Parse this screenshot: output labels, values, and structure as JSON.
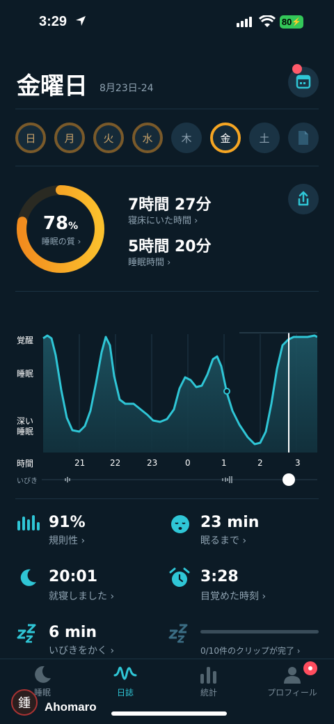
{
  "status": {
    "time": "3:29",
    "battery": "80"
  },
  "header": {
    "title": "金曜日",
    "date_range": "8月23日-24"
  },
  "week": [
    "日",
    "月",
    "火",
    "水",
    "木",
    "金",
    "土"
  ],
  "summary": {
    "score": "78",
    "score_unit": "%",
    "score_label": "睡眠の質 ›",
    "time_in_bed": "7時間 27分",
    "time_in_bed_label": "寝床にいた時間 ›",
    "time_asleep": "5時間 20分",
    "time_asleep_label": "睡眠時間 ›",
    "score_fraction": 0.78
  },
  "chart_data": {
    "type": "area",
    "y_levels": [
      "覚醒",
      "睡眠",
      "深い\n睡眠"
    ],
    "x_row_label": "時間",
    "x_ticks": [
      "21",
      "22",
      "23",
      "0",
      "1",
      "2",
      "3"
    ],
    "snore_row_label": "いびき"
  },
  "stats": {
    "regularity": {
      "value": "91%",
      "label": "規則性 ›"
    },
    "to_sleep": {
      "value": "23 min",
      "label": "眠るまで ›"
    },
    "bedtime": {
      "value": "20:01",
      "label": "就寝しました ›"
    },
    "wakeup": {
      "value": "3:28",
      "label": "目覚めた時刻 ›"
    },
    "snoring": {
      "value": "6 min",
      "label": "いびきをかく ›"
    },
    "clips": {
      "label": "0/10件のクリップが完了 ›"
    }
  },
  "tabs": [
    {
      "label": "睡眠"
    },
    {
      "label": "日誌"
    },
    {
      "label": "統計"
    },
    {
      "label": "プロフィール"
    }
  ],
  "watermark": {
    "name": "Ahomaro",
    "logo": "鍾"
  },
  "colors": {
    "accent": "#2fc6d6",
    "score": "#f6a623",
    "background": "#0c1b26"
  }
}
